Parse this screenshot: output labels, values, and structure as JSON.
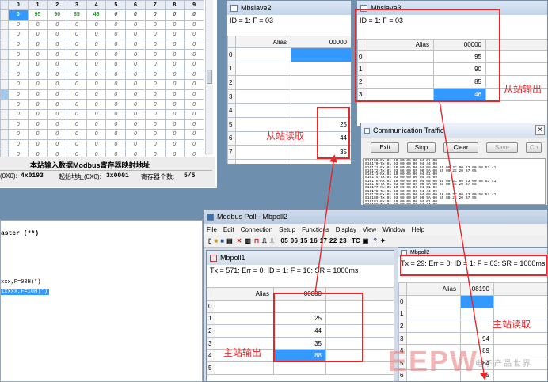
{
  "slave_app": {
    "col_headers": [
      "0",
      "1",
      "2",
      "3",
      "4",
      "5",
      "6",
      "7",
      "8",
      "9"
    ],
    "first_row": [
      "0",
      "95",
      "90",
      "85",
      "46",
      "0",
      "0",
      "0",
      "0",
      "0"
    ],
    "fill_value": "0",
    "group_title": "本站输入数据Modbus寄存器映射地址",
    "left_cut": "(0X0):",
    "addr_value": "4x0193",
    "start_label": "起始地址(0X0):",
    "start_value": "3x0001",
    "count_label": "寄存器个数:",
    "count_value": "5/5"
  },
  "left_text": {
    "line1": "aster (**)",
    "line2": "xxx,F=03H)*)",
    "line3": "lxxxx,F=10H)*)"
  },
  "mbslave2": {
    "title": "Mbslave2",
    "status": "ID = 1: F = 03",
    "alias_header": "Alias",
    "col_header": "00000",
    "rows": [
      {
        "idx": "0",
        "value": "",
        "selected": true
      },
      {
        "idx": "1",
        "value": ""
      },
      {
        "idx": "2",
        "value": ""
      },
      {
        "idx": "3",
        "value": ""
      },
      {
        "idx": "4",
        "value": ""
      },
      {
        "idx": "5",
        "value": "25"
      },
      {
        "idx": "6",
        "value": "44"
      },
      {
        "idx": "7",
        "value": "35"
      },
      {
        "idx": "8",
        "value": "88"
      }
    ]
  },
  "mbslave3": {
    "title": "Mbslave3",
    "status": "ID = 1: F = 03",
    "alias_header": "Alias",
    "col_header": "00000",
    "rows": [
      {
        "idx": "0",
        "value": "95"
      },
      {
        "idx": "1",
        "value": "90"
      },
      {
        "idx": "2",
        "value": "85"
      },
      {
        "idx": "3",
        "value": "46",
        "selected": true
      }
    ]
  },
  "traffic": {
    "title": "Communication Traffic",
    "close": "×",
    "exit_label": "Exit",
    "stop_label": "Stop",
    "clear_label": "Clear",
    "save_label": "Save",
    "copy_label": "Co",
    "lines": [
      "016169-Rx:01 10 00 05 00 04 01 00",
      "016170-Tx:01 03 00 00 00 04 44 09",
      "016171-Rx:01 10 00 05 00 04 08 00 19 00 2C 00 23 00 58 53 41",
      "016172-Tx:01 03 08 00 5F 00 5A 00 55 00 2E 20 B7 05",
      "016173-Rx:01 10 00 05 00 04 01 00",
      "016174-Tx:01 03 00 00 00 04 44 09",
      "016175-Rx:01 10 00 05 00 04 08 00 19 00 2C 00 23 00 58 53 41",
      "016176-Tx:01 03 08 00 5F 00 5A 00 55 00 2E 20 B7 05",
      "016177-Rx:01 10 00 05 00 04 01 00",
      "016178-Tx:01 03 00 00 00 04 44 09",
      "016179-Rx:01 10 00 05 00 04 08 00 19 00 2C 00 23 00 58 53 41",
      "016180-Tx:01 03 08 00 5F 00 5A 00 55 00 2E 20 B7 05",
      "016181-Rx:01 10 00 05 00 04 01 00",
      "016182-Tx:01 03 00 00 00 04 44 09"
    ]
  },
  "mbpoll_app": {
    "title": "Modbus Poll - Mbpoll2",
    "menu": [
      "File",
      "Edit",
      "Connection",
      "Setup",
      "Functions",
      "Display",
      "View",
      "Window",
      "Help"
    ],
    "func_codes": "05 06 15 16 17 22 23",
    "tc_label": "TC"
  },
  "mbpoll1": {
    "title": "Mbpoll1",
    "status": "Tx = 571: Err = 0: ID = 1: F = 16: SR = 1000ms",
    "alias_header": "Alias",
    "col_header": "00000",
    "rows": [
      {
        "idx": "0",
        "value": ""
      },
      {
        "idx": "1",
        "value": "25"
      },
      {
        "idx": "2",
        "value": "44"
      },
      {
        "idx": "3",
        "value": "35"
      },
      {
        "idx": "4",
        "value": "88",
        "selected": true
      },
      {
        "idx": "5",
        "value": ""
      }
    ]
  },
  "mbpoll2": {
    "title": "Mbpoll2",
    "status": "Tx = 29: Err = 0: ID = 1: F = 03: SR = 1000ms",
    "alias_header": "Alias",
    "col_header": "08190",
    "rows": [
      {
        "idx": "0",
        "value": "",
        "selected": true
      },
      {
        "idx": "1",
        "value": ""
      },
      {
        "idx": "2",
        "value": ""
      },
      {
        "idx": "3",
        "value": "94"
      },
      {
        "idx": "4",
        "value": "89"
      },
      {
        "idx": "5",
        "value": "84"
      },
      {
        "idx": "6",
        "value": "45"
      }
    ]
  },
  "annotations": {
    "slave_read": "从站读取",
    "slave_output": "从站输出",
    "master_output": "主站输出",
    "master_read": "主站读取"
  },
  "watermark": {
    "text": "EEPW",
    "sub": "电子产品世界"
  },
  "colors": {
    "annotation": "#e8262a",
    "selection": "#3399ff",
    "value_green": "#1f9a1f"
  }
}
